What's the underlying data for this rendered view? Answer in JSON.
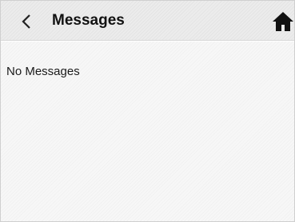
{
  "header": {
    "title": "Messages",
    "back_icon": "chevron-left-icon",
    "home_icon": "home-icon"
  },
  "content": {
    "empty_text": "No Messages"
  },
  "colors": {
    "header_background": "#ececec",
    "content_background": "#f7f7f7",
    "text": "#111111"
  }
}
